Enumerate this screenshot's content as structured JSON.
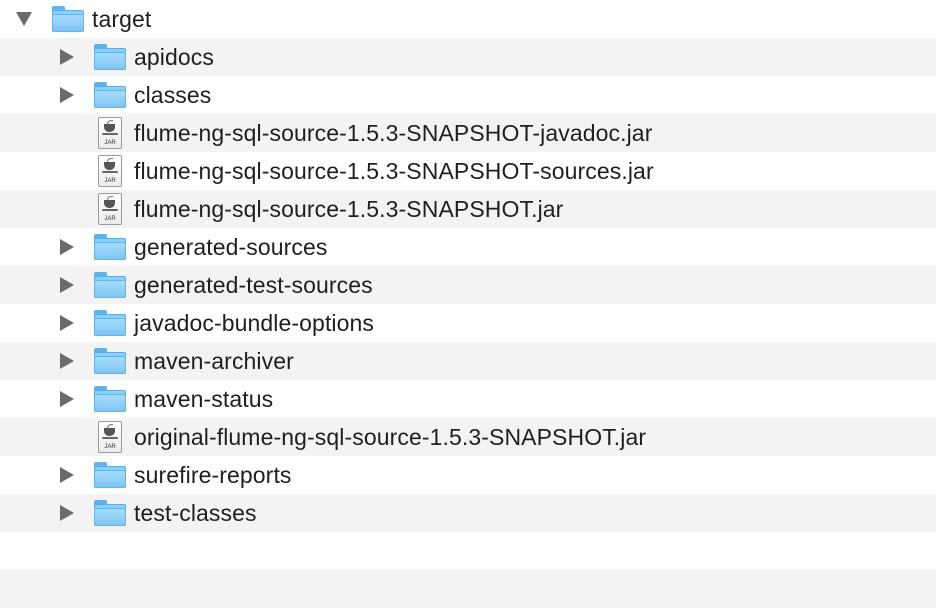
{
  "root": {
    "label": "target",
    "expanded": true
  },
  "items": [
    {
      "label": "apidocs",
      "kind": "folder",
      "expandable": true
    },
    {
      "label": "classes",
      "kind": "folder",
      "expandable": true
    },
    {
      "label": "flume-ng-sql-source-1.5.3-SNAPSHOT-javadoc.jar",
      "kind": "jar",
      "expandable": false
    },
    {
      "label": "flume-ng-sql-source-1.5.3-SNAPSHOT-sources.jar",
      "kind": "jar",
      "expandable": false
    },
    {
      "label": "flume-ng-sql-source-1.5.3-SNAPSHOT.jar",
      "kind": "jar",
      "expandable": false
    },
    {
      "label": "generated-sources",
      "kind": "folder",
      "expandable": true
    },
    {
      "label": "generated-test-sources",
      "kind": "folder",
      "expandable": true
    },
    {
      "label": "javadoc-bundle-options",
      "kind": "folder",
      "expandable": true
    },
    {
      "label": "maven-archiver",
      "kind": "folder",
      "expandable": true
    },
    {
      "label": "maven-status",
      "kind": "folder",
      "expandable": true
    },
    {
      "label": "original-flume-ng-sql-source-1.5.3-SNAPSHOT.jar",
      "kind": "jar",
      "expandable": false
    },
    {
      "label": "surefire-reports",
      "kind": "folder",
      "expandable": true
    },
    {
      "label": "test-classes",
      "kind": "folder",
      "expandable": true
    }
  ],
  "jar_badge": "JAR",
  "colors": {
    "stripe": "#f3f3f4",
    "folder": "#7cc6f5",
    "text": "#1f1f1f"
  },
  "icons": {
    "folder": "folder-icon",
    "jar": "jar-file-icon",
    "collapsed": "disclosure-triangle-right-icon",
    "expanded": "disclosure-triangle-down-icon"
  }
}
